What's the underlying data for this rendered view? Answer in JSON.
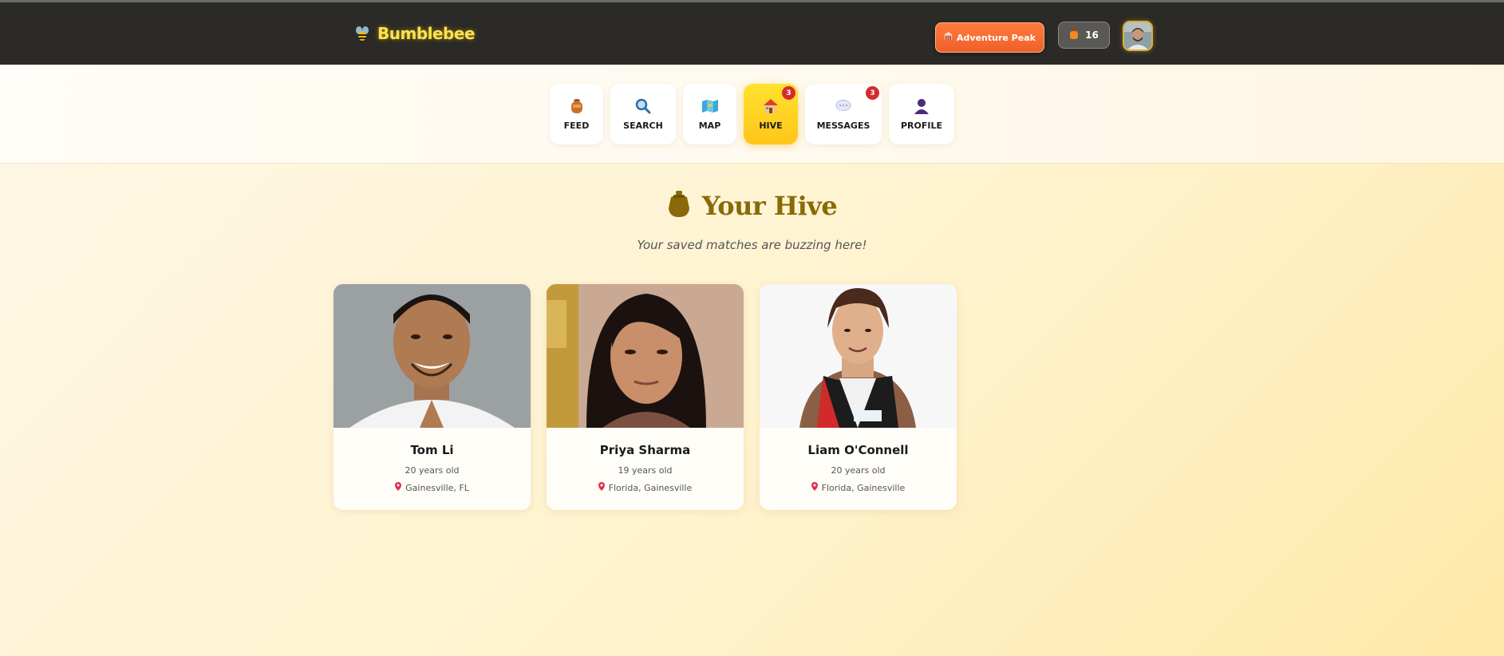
{
  "header": {
    "brand": "Bumblebee",
    "adventure_button": "Adventure Peak",
    "coins": "16"
  },
  "nav": {
    "items": [
      {
        "label": "FEED",
        "icon": "honey-pot-icon",
        "active": false
      },
      {
        "label": "SEARCH",
        "icon": "magnifier-icon",
        "active": false
      },
      {
        "label": "MAP",
        "icon": "map-icon",
        "active": false
      },
      {
        "label": "HIVE",
        "icon": "house-icon",
        "active": true,
        "badge": "3"
      },
      {
        "label": "MESSAGES",
        "icon": "speech-bubble-icon",
        "active": false,
        "badge": "3"
      },
      {
        "label": "PROFILE",
        "icon": "person-icon",
        "active": false
      }
    ]
  },
  "main": {
    "title": "Your Hive",
    "subtitle": "Your saved matches are buzzing here!"
  },
  "matches": [
    {
      "name": "Tom Li",
      "age": "20 years old",
      "location": "Gainesville, FL"
    },
    {
      "name": "Priya Sharma",
      "age": "19 years old",
      "location": "Florida, Gainesville"
    },
    {
      "name": "Liam O'Connell",
      "age": "20 years old",
      "location": "Florida, Gainesville"
    }
  ],
  "colors": {
    "header_bg": "#2b2a27",
    "brand": "#ffe14d",
    "accent_orange": "#f0602a",
    "active_tab": "#ffd21f",
    "title": "#8a6a08",
    "badge": "#d62b2b"
  }
}
